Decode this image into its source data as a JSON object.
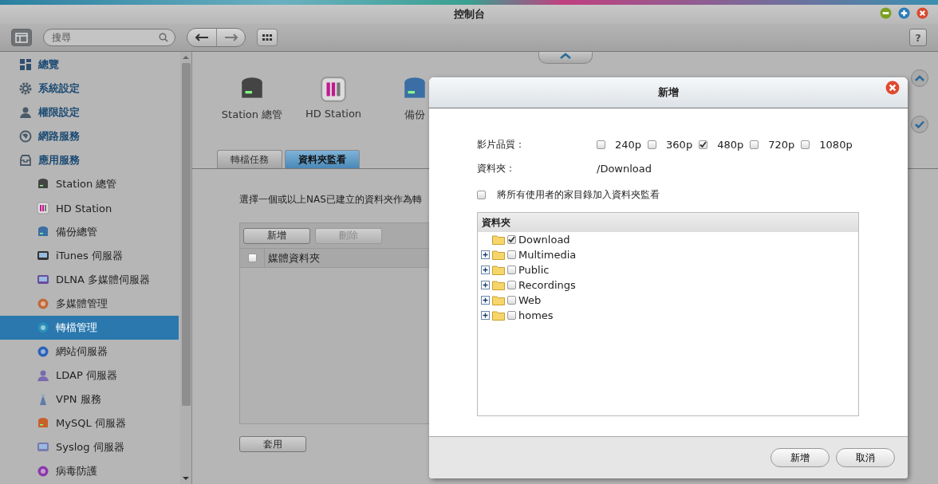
{
  "window": {
    "title": "控制台",
    "help": "?"
  },
  "search": {
    "placeholder": "搜尋"
  },
  "sidebar": {
    "items": [
      {
        "label": "總覽",
        "selected": false
      },
      {
        "label": "系統設定",
        "selected": false
      },
      {
        "label": "權限設定",
        "selected": false
      },
      {
        "label": "網路服務",
        "selected": false
      },
      {
        "label": "應用服務",
        "selected": false,
        "children": [
          {
            "label": "Station 總管",
            "selected": false
          },
          {
            "label": "HD Station",
            "selected": false
          },
          {
            "label": "備份總管",
            "selected": false
          },
          {
            "label": "iTunes 伺服器",
            "selected": false
          },
          {
            "label": "DLNA 多媒體伺服器",
            "selected": false
          },
          {
            "label": "多媒體管理",
            "selected": false
          },
          {
            "label": "轉檔管理",
            "selected": true
          },
          {
            "label": "網站伺服器",
            "selected": false
          },
          {
            "label": "LDAP 伺服器",
            "selected": false
          },
          {
            "label": "VPN 服務",
            "selected": false
          },
          {
            "label": "MySQL 伺服器",
            "selected": false
          },
          {
            "label": "Syslog 伺服器",
            "selected": false
          },
          {
            "label": "病毒防護",
            "selected": false
          }
        ]
      }
    ]
  },
  "app_icons": [
    {
      "label": "Station 總管"
    },
    {
      "label": "HD Station"
    },
    {
      "label": "備份"
    }
  ],
  "tabs": [
    {
      "label": "轉檔任務",
      "selected": false
    },
    {
      "label": "資料夾監看",
      "selected": true
    }
  ],
  "description": "選擇一個或以上NAS已建立的資料夾作為轉",
  "panel": {
    "buttons": [
      {
        "label": "新增",
        "disabled": false
      },
      {
        "label": "刪除",
        "disabled": true
      }
    ],
    "header_checkbox": {
      "checked": false
    },
    "columns": [
      "媒體資料夾"
    ]
  },
  "apply_button": "套用",
  "dialog": {
    "title": "新增",
    "quality_label": "影片品質：",
    "quality_options": [
      {
        "label": "240p",
        "checked": false
      },
      {
        "label": "360p",
        "checked": false
      },
      {
        "label": "480p",
        "checked": true
      },
      {
        "label": "720p",
        "checked": false
      },
      {
        "label": "1080p",
        "checked": false
      }
    ],
    "folder_label": "資料夾：",
    "folder_value": "/Download",
    "home_option": {
      "label": "將所有使用者的家目錄加入資料夾監看",
      "checked": false
    },
    "tree": {
      "header": "資料夾",
      "items": [
        {
          "label": "Download",
          "checked": true,
          "expandable": false
        },
        {
          "label": "Multimedia",
          "checked": false,
          "expandable": true
        },
        {
          "label": "Public",
          "checked": false,
          "expandable": true
        },
        {
          "label": "Recordings",
          "checked": false,
          "expandable": true
        },
        {
          "label": "Web",
          "checked": false,
          "expandable": true
        },
        {
          "label": "homes",
          "checked": false,
          "expandable": true
        }
      ]
    },
    "buttons": [
      "新增",
      "取消"
    ]
  }
}
